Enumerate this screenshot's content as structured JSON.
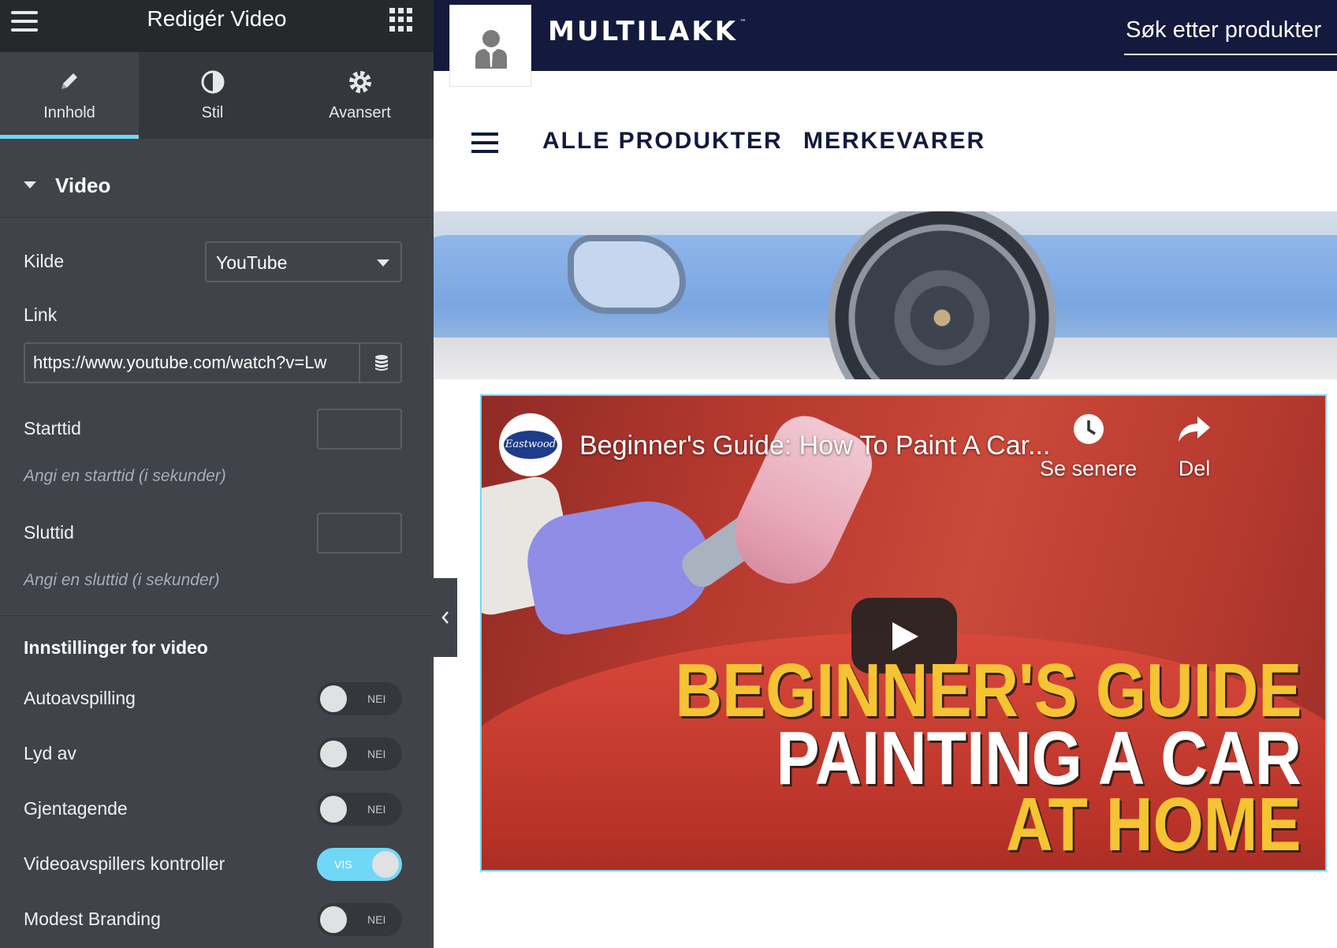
{
  "panel": {
    "title": "Redigér Video",
    "tabs": [
      {
        "label": "Innhold",
        "icon": "pencil-icon",
        "active": true
      },
      {
        "label": "Stil",
        "icon": "half-circle-icon",
        "active": false
      },
      {
        "label": "Avansert",
        "icon": "gear-icon",
        "active": false
      }
    ],
    "section_title": "Video",
    "source": {
      "label": "Kilde",
      "value": "YouTube"
    },
    "link": {
      "label": "Link",
      "value": "https://www.youtube.com/watch?v=Lw"
    },
    "start": {
      "label": "Starttid",
      "hint": "Angi en starttid (i sekunder)"
    },
    "end": {
      "label": "Sluttid",
      "hint": "Angi en sluttid (i sekunder)"
    },
    "settings_title": "Innstillinger for video",
    "toggles": [
      {
        "label": "Autoavspilling",
        "state": "NEI",
        "on": false
      },
      {
        "label": "Lyd av",
        "state": "NEI",
        "on": false
      },
      {
        "label": "Gjentagende",
        "state": "NEI",
        "on": false
      },
      {
        "label": "Videoavspillers kontroller",
        "state": "VIS",
        "on": true
      },
      {
        "label": "Modest Branding",
        "state": "NEI",
        "on": false
      }
    ],
    "accent_color": "#71d7f7"
  },
  "site": {
    "brand": "MULTILAKK",
    "brand_mark": "™",
    "search_placeholder": "Søk etter produkter",
    "nav": [
      "ALLE PRODUKTER",
      "MERKEVARER"
    ],
    "header_color": "#131a3d"
  },
  "video": {
    "channel": "Eastwood",
    "title": "Beginner's Guide: How To Paint A Car...",
    "watch_later": "Se senere",
    "share": "Del",
    "overlay_lines": [
      "BEGINNER'S GUIDE",
      "PAINTING A CAR",
      "AT HOME"
    ]
  }
}
